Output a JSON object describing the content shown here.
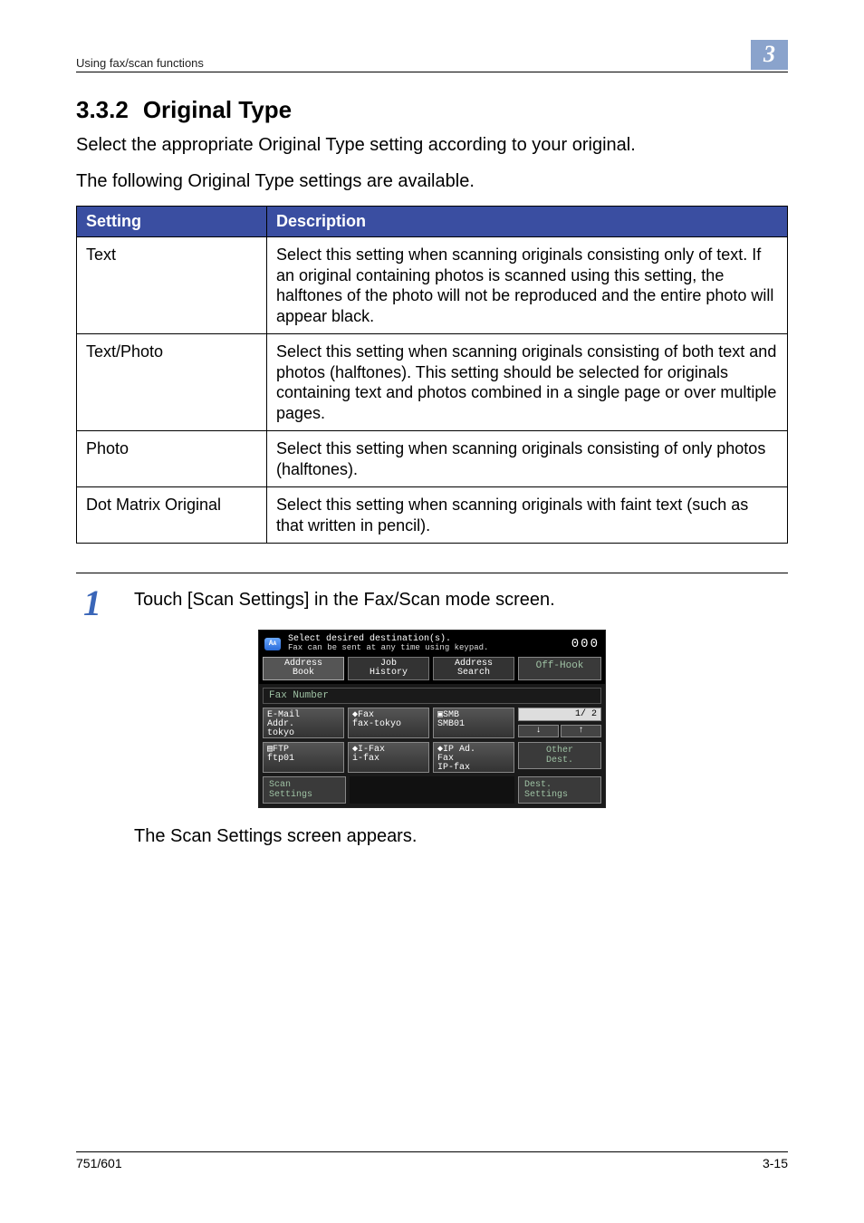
{
  "header": {
    "running_head": "Using fax/scan functions",
    "section_badge": "3"
  },
  "section": {
    "number": "3.3.2",
    "title": "Original Type",
    "intro1": "Select the appropriate Original Type setting according to your original.",
    "intro2": "The following Original Type settings are available."
  },
  "table": {
    "col_setting": "Setting",
    "col_description": "Description",
    "rows": [
      {
        "setting": "Text",
        "desc": "Select this setting when scanning originals consisting only of text. If an original containing photos is scanned using this setting, the halftones of the photo will not be reproduced and the entire photo will appear black."
      },
      {
        "setting": "Text/Photo",
        "desc": "Select this setting when scanning originals consisting of both text and photos (halftones). This setting should be selected for originals containing text and photos combined in a single page or over multiple pages."
      },
      {
        "setting": "Photo",
        "desc": "Select this setting when scanning originals consisting of only photos (halftones)."
      },
      {
        "setting": "Dot Matrix Original",
        "desc": "Select this setting when scanning originals with faint text (such as that written in pencil)."
      }
    ]
  },
  "step": {
    "number": "1",
    "text": "Touch [Scan Settings] in the Fax/Scan mode screen.",
    "after": "The Scan Settings screen appears."
  },
  "device": {
    "title1": "Select desired destination(s).",
    "title2": "Fax can be sent at any time using keypad.",
    "counter": "000",
    "tabs": {
      "address_book": "Address\nBook",
      "job_history": "Job\nHistory",
      "address_search": "Address\nSearch"
    },
    "off_hook": "Off-Hook",
    "fax_number_label": "Fax Number",
    "destinations": [
      {
        "type": "E-Mail\nAddr.",
        "name": "tokyo"
      },
      {
        "type": "Fax",
        "name": "fax-tokyo"
      },
      {
        "type": "SMB",
        "name": "SMB01"
      },
      {
        "type": "FTP",
        "name": "ftp01"
      },
      {
        "type": "I-Fax",
        "name": "i-fax"
      },
      {
        "type": "IP Ad.\nFax",
        "name": "IP-fax"
      }
    ],
    "page_indicator": "1/  2",
    "arrow_down": "↓",
    "arrow_up": "↑",
    "other_dest": "Other\nDest.",
    "scan_settings": "Scan\nSettings",
    "dest_settings": "Dest.\nSettings"
  },
  "footer": {
    "left": "751/601",
    "right": "3-15"
  }
}
